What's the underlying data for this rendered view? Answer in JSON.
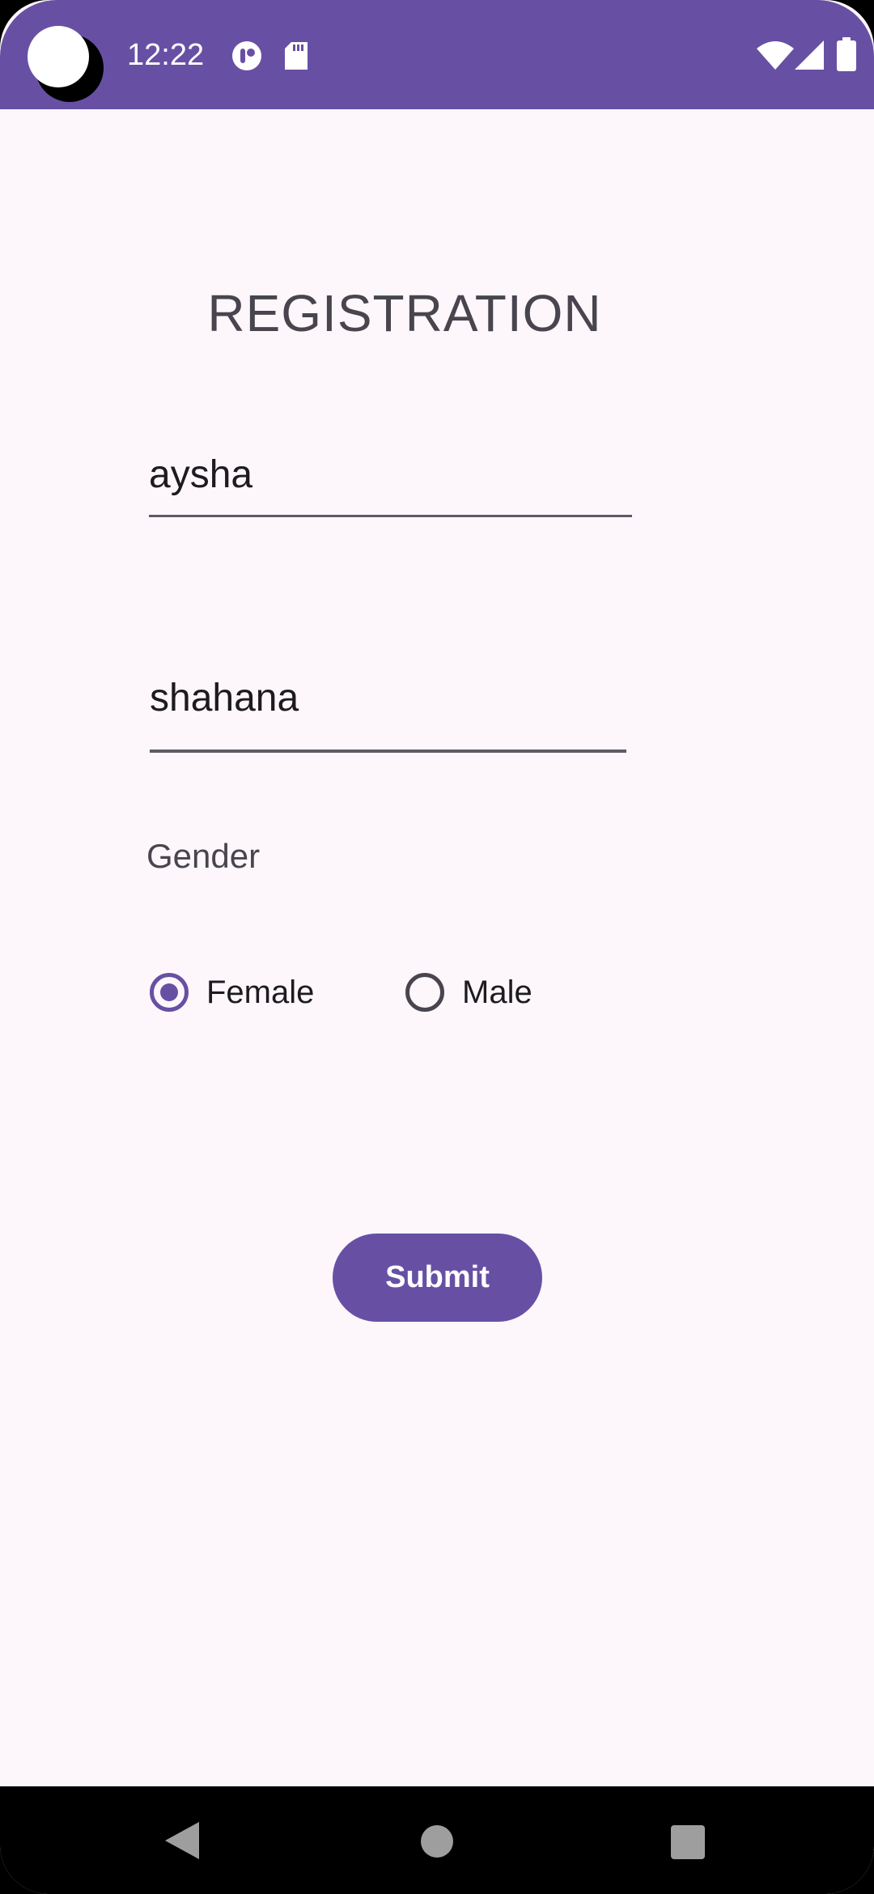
{
  "status_bar": {
    "time": "12:22",
    "left_icons": [
      "camera-cutout",
      "pocket-icon",
      "sd-card-icon"
    ],
    "right_icons": [
      "wifi-icon",
      "signal-icon",
      "battery-icon"
    ],
    "background": "#6750a4"
  },
  "form": {
    "title": "REGISTRATION",
    "first_name_value": "aysha",
    "last_name_value": "shahana",
    "gender_label": "Gender",
    "gender_options": [
      {
        "label": "Female",
        "checked": true
      },
      {
        "label": "Male",
        "checked": false
      }
    ],
    "submit_label": "Submit"
  },
  "nav_bar": {
    "buttons": [
      "back-icon",
      "home-icon",
      "recents-icon"
    ]
  },
  "colors": {
    "accent": "#6750a4",
    "background": "#fdf7fb",
    "text": "#1d1b20",
    "muted_text": "#48454f"
  }
}
